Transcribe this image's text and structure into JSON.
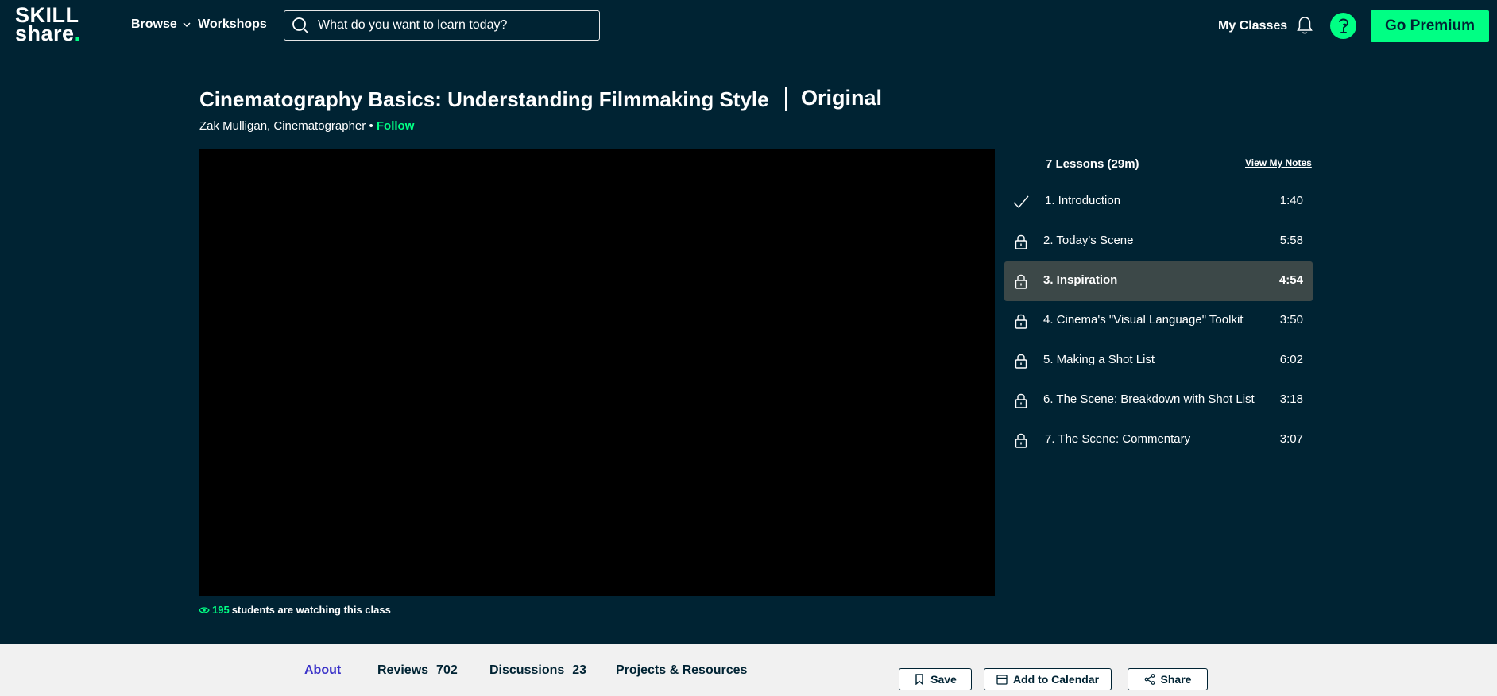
{
  "header": {
    "logo": {
      "line1": "SKILL",
      "line2": "share"
    },
    "nav": {
      "browse": "Browse",
      "workshops": "Workshops"
    },
    "search": {
      "placeholder": "What do you want to learn today?"
    },
    "my_classes": "My Classes",
    "premium_button": "Go Premium",
    "icons": [
      "search-icon",
      "chevron-down-icon",
      "bell-icon",
      "avatar-icon"
    ]
  },
  "class_info": {
    "title": "Cinematography Basics: Understanding Filmmaking Style",
    "badge": "Original",
    "teacher": "Zak Mulligan, Cinematographer",
    "separator": "•",
    "follow": "Follow",
    "watching_count": "195",
    "watching_text": "students are watching this class"
  },
  "lessons": {
    "summary": "7 Lessons (29m)",
    "view_notes": "View My Notes",
    "items": [
      {
        "title": "1. Introduction",
        "duration": "1:40",
        "status": "completed",
        "icon": "checkmark-icon"
      },
      {
        "title": "2. Today's Scene",
        "duration": "5:58",
        "status": "locked",
        "icon": "lock-icon"
      },
      {
        "title": "3. Inspiration",
        "duration": "4:54",
        "status": "locked",
        "icon": "lock-icon",
        "active": true
      },
      {
        "title": "4. Cinema's \"Visual Language\" Toolkit",
        "duration": "3:50",
        "status": "locked",
        "icon": "lock-icon"
      },
      {
        "title": "5. Making a Shot List",
        "duration": "6:02",
        "status": "locked",
        "icon": "lock-icon"
      },
      {
        "title": "6. The Scene: Breakdown with Shot List",
        "duration": "3:18",
        "status": "locked",
        "icon": "lock-icon"
      },
      {
        "title": "7. The Scene: Commentary",
        "duration": "3:07",
        "status": "locked",
        "icon": "lock-icon"
      }
    ]
  },
  "tabs": {
    "about": "About",
    "reviews": {
      "label": "Reviews",
      "count": "702"
    },
    "discussions": {
      "label": "Discussions",
      "count": "23"
    },
    "projects": "Projects & Resources"
  },
  "actions": {
    "save": "Save",
    "calendar": "Add to Calendar",
    "share": "Share"
  },
  "colors": {
    "background": "#002333",
    "accent": "#00ff84",
    "active_tab": "#3b33c9",
    "active_lesson": "#3c4848",
    "bottom_bar": "#f1f1f1"
  }
}
